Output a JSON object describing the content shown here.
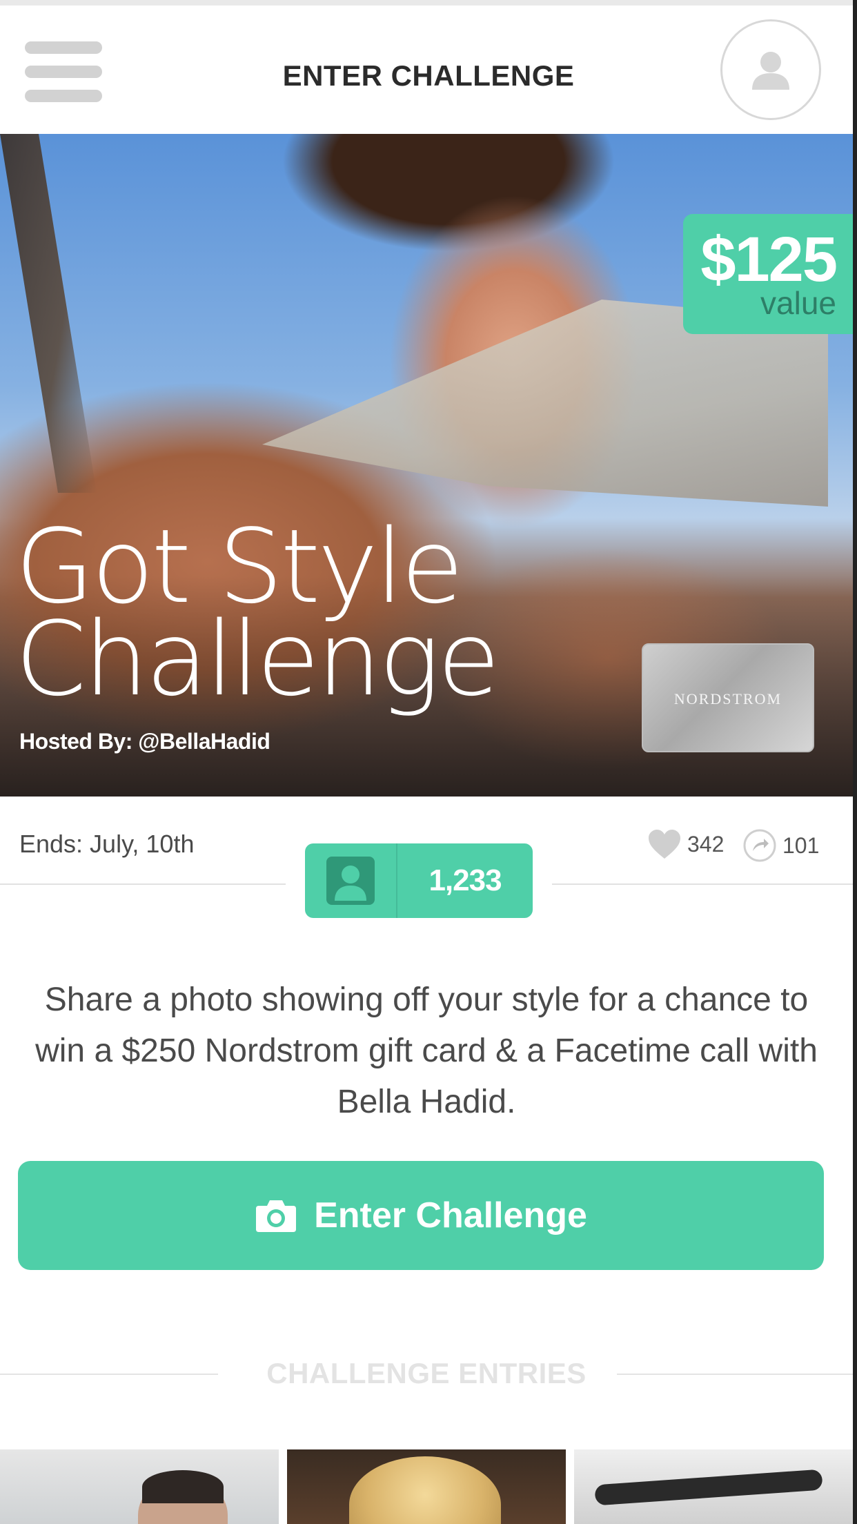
{
  "header": {
    "title": "ENTER CHALLENGE"
  },
  "hero": {
    "title_line1": "Got Style",
    "title_line2": "Challenge",
    "host": "Hosted By: @BellaHadid",
    "prize_amount": "$125",
    "prize_label": "value",
    "gift_card_label": "NORDSTROM"
  },
  "meta": {
    "ends": "Ends: July, 10th",
    "entrants_count": "1,233",
    "likes": "342",
    "shares": "101"
  },
  "description": "Share a photo showing off your style for a chance to win a $250 Nordstrom gift card & a Facetime call with Bella Hadid.",
  "cta": {
    "label": "Enter Challenge"
  },
  "entries": {
    "heading": "CHALLENGE ENTRIES"
  },
  "colors": {
    "accent": "#4fcfa8",
    "text": "#4a4a4a"
  }
}
